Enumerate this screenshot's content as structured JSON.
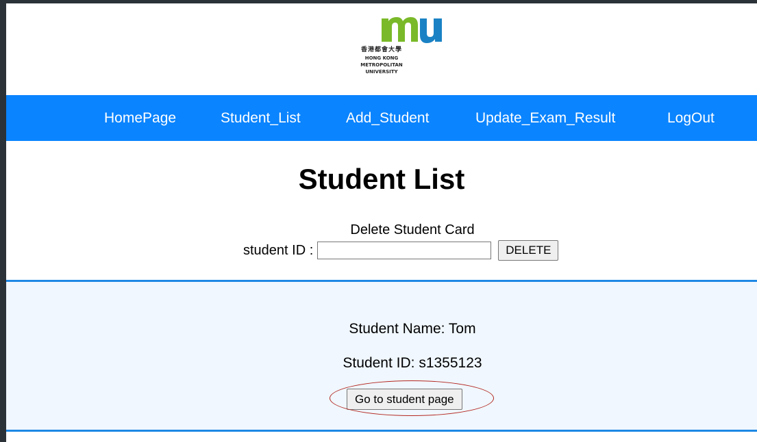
{
  "logo": {
    "chinese": "香港都會大學",
    "line1": "HONG KONG",
    "line2": "METROPOLITAN",
    "line3": "UNIVERSITY",
    "colors": {
      "m": "#7ab929",
      "u": "#1a82c4"
    }
  },
  "nav": {
    "items": [
      {
        "label": "HomePage"
      },
      {
        "label": "Student_List"
      },
      {
        "label": "Add_Student"
      },
      {
        "label": "Update_Exam_Result"
      },
      {
        "label": "LogOut"
      }
    ],
    "bg_color": "#0a84ff"
  },
  "page": {
    "title": "Student List"
  },
  "delete_form": {
    "heading": "Delete Student Card",
    "label": "student ID :",
    "input_value": "",
    "button_label": "DELETE"
  },
  "student_card": {
    "name_line": "Student Name: Tom",
    "id_line": "Student ID: s1355123",
    "button_label": "Go to student page"
  }
}
